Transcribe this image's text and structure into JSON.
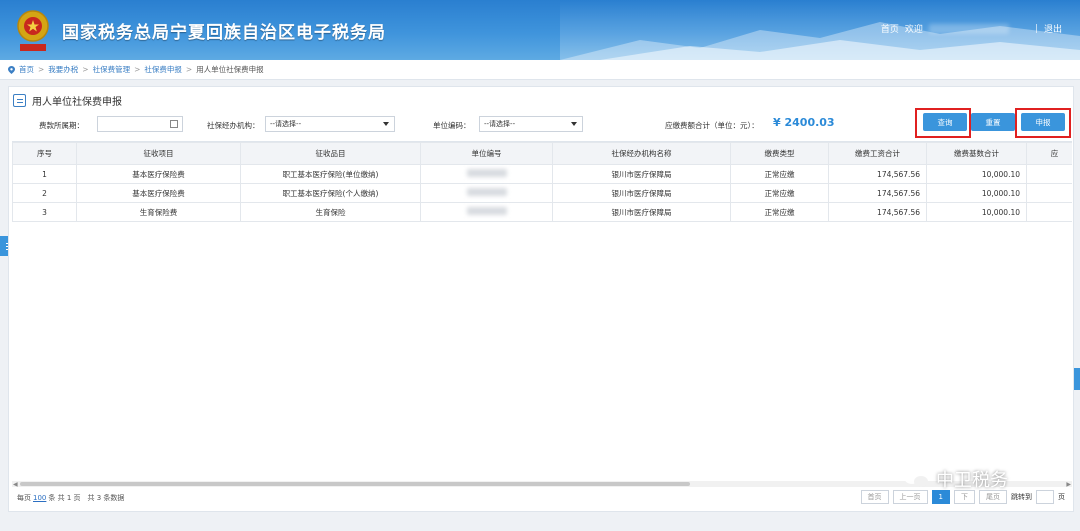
{
  "header": {
    "site_title": "国家税务总局宁夏回族自治区电子税务局",
    "links": [
      "首页",
      "欢迎",
      "退出"
    ]
  },
  "breadcrumb": [
    "首页",
    "我要办税",
    "社保费管理",
    "社保费申报",
    "用人单位社保费申报"
  ],
  "panel": {
    "title": "用人单位社保费申报",
    "filters": {
      "period_label": "费款所属期：",
      "agency_label": "社保经办机构：",
      "agency_value": "--请选择--",
      "unit_code_label": "单位编码：",
      "unit_code_value": "--请选择--"
    },
    "total_label": "应缴费额合计（单位：元）：",
    "total_value": "¥ 2400.03",
    "buttons": {
      "query": "查询",
      "reset": "重置",
      "declare": "申报"
    }
  },
  "table": {
    "columns": [
      "序号",
      "征收项目",
      "征收品目",
      "单位编号",
      "社保经办机构名称",
      "缴费类型",
      "缴费工资合计",
      "缴费基数合计",
      "应"
    ],
    "rows": [
      [
        "1",
        "基本医疗保险费",
        "职工基本医疗保险(单位缴纳)",
        "",
        "银川市医疗保障局",
        "正常应缴",
        "174,567.56",
        "10,000.10",
        ""
      ],
      [
        "2",
        "基本医疗保险费",
        "职工基本医疗保险(个人缴纳)",
        "",
        "银川市医疗保障局",
        "正常应缴",
        "174,567.56",
        "10,000.10",
        ""
      ],
      [
        "3",
        "生育保险费",
        "生育保险",
        "",
        "银川市医疗保障局",
        "正常应缴",
        "174,567.56",
        "10,000.10",
        ""
      ]
    ]
  },
  "footer": {
    "per_page_prefix": "每页",
    "per_page": "100",
    "summary": "条 共 1 页　共 3 条数据"
  },
  "pager": {
    "first": "首页",
    "prev": "上一页",
    "current": "1",
    "next": "下",
    "last": "尾页",
    "goto": "跳转到",
    "page_unit": "页"
  },
  "watermark": "中卫税务",
  "colors": {
    "accent": "#3a95dc",
    "highlight": "#e02020",
    "header": "#2a7fd0"
  }
}
